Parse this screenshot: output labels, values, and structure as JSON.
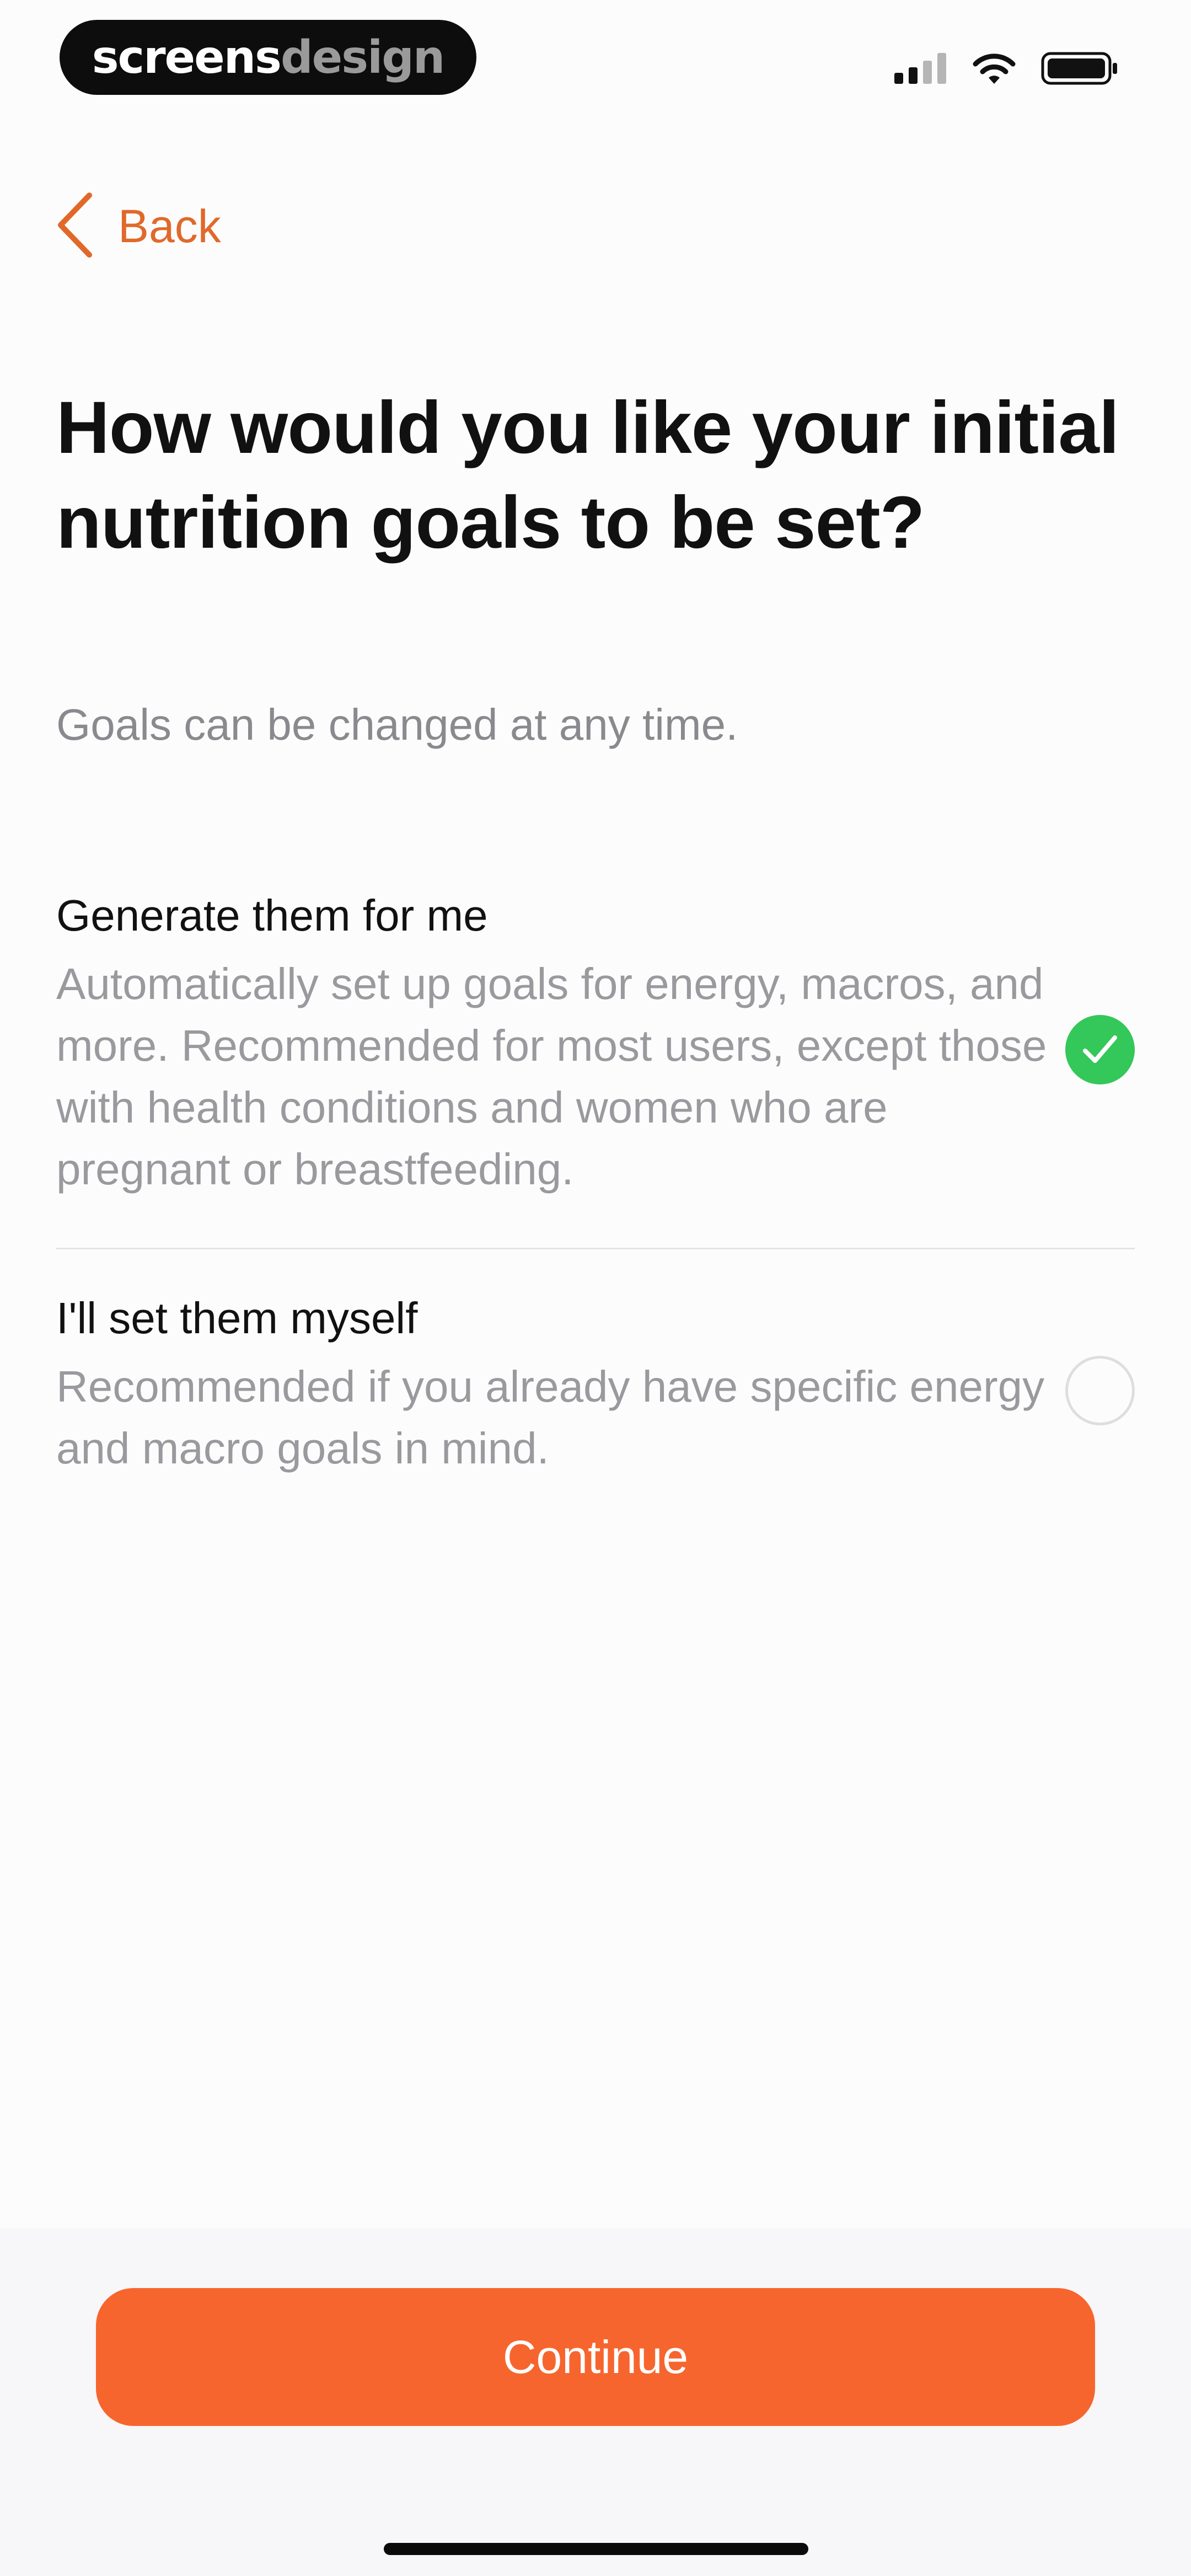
{
  "status_bar": {
    "logo_part_1": "screens",
    "logo_part_2": "design",
    "signal_icon": "cellular-signal-icon",
    "wifi_icon": "wifi-icon",
    "battery_icon": "battery-icon"
  },
  "nav": {
    "back_label": "Back",
    "back_icon": "chevron-left-icon",
    "accent_color": "#e0692a"
  },
  "content": {
    "title": "How would you like your initial nutrition goals to be set?",
    "subtitle": "Goals can be changed at any time."
  },
  "options": [
    {
      "title": "Generate them for me",
      "description": "Automatically set up goals for energy, macros, and more. Recommended for most users, except those with health conditions and women who are pregnant or breastfeeding.",
      "selected": true
    },
    {
      "title": "I'll set them myself",
      "description": "Recommended if you already have specific energy and macro goals in mind.",
      "selected": false
    }
  ],
  "footer": {
    "continue_label": "Continue",
    "button_color": "#f7652e"
  },
  "colors": {
    "selected_check": "#34c759",
    "secondary_text": "#9a9a9e"
  }
}
